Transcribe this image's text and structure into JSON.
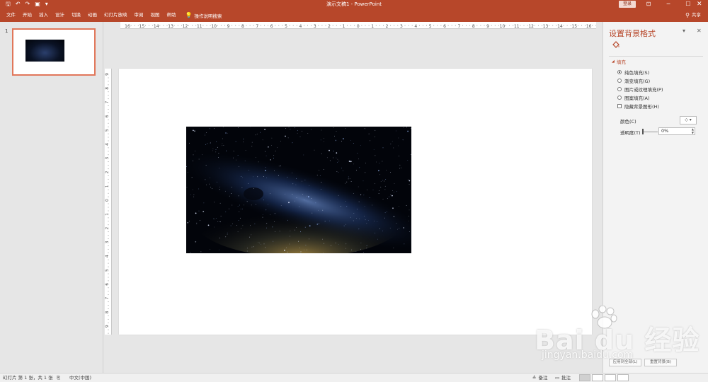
{
  "titlebar": {
    "title": "演示文稿1  -  PowerPoint",
    "login_label": "登录",
    "qat_icons": [
      "save-icon",
      "undo-icon",
      "redo-icon",
      "start-from-beginning-icon",
      "customize-qat-icon"
    ],
    "window_controls": [
      "ribbon-display-icon",
      "minimize-icon",
      "restore-icon",
      "close-icon"
    ]
  },
  "ribbon": {
    "tabs": [
      "文件",
      "开始",
      "插入",
      "设计",
      "切换",
      "动画",
      "幻灯片放映",
      "审阅",
      "视图",
      "帮助"
    ],
    "tell_me": "操作说明搜索",
    "share": "共享"
  },
  "thumbnails": {
    "items": [
      {
        "number": "1"
      }
    ]
  },
  "rulers": {
    "horizontal_labels": [
      "16",
      "15",
      "14",
      "13",
      "12",
      "11",
      "10",
      "9",
      "8",
      "7",
      "6",
      "5",
      "4",
      "3",
      "2",
      "1",
      "0",
      "1",
      "2",
      "3",
      "4",
      "5",
      "6",
      "7",
      "8",
      "9",
      "10",
      "11",
      "12",
      "13",
      "14",
      "15",
      "16"
    ],
    "vertical_labels": [
      "9",
      "8",
      "7",
      "6",
      "5",
      "4",
      "3",
      "2",
      "1",
      "0",
      "1",
      "2",
      "3",
      "4",
      "5",
      "6",
      "7",
      "8",
      "9"
    ]
  },
  "taskpane": {
    "title": "设置背景格式",
    "section": "填充",
    "options": [
      {
        "label": "纯色填充(S)",
        "selected": true
      },
      {
        "label": "渐变填充(G)",
        "selected": false
      },
      {
        "label": "图片或纹理填充(P)",
        "selected": false
      },
      {
        "label": "图案填充(A)",
        "selected": false
      }
    ],
    "hide_bg_graphics": "隐藏背景图形(H)",
    "color_label": "颜色(C)",
    "transparency_label": "透明度(T)",
    "transparency_value": "0%",
    "apply_all": "应用到全部(L)",
    "reset": "重置背景(B)"
  },
  "statusbar": {
    "slide_info": "幻灯片 第 1 张，共 1 张",
    "language": "中文(中国)",
    "notes": "备注",
    "comments": "批注"
  },
  "watermark": {
    "text": "Bai du 经验",
    "sub": "jingyan.baidu.com"
  },
  "colors": {
    "accent": "#b7472a",
    "thumb_border": "#e1775a"
  }
}
